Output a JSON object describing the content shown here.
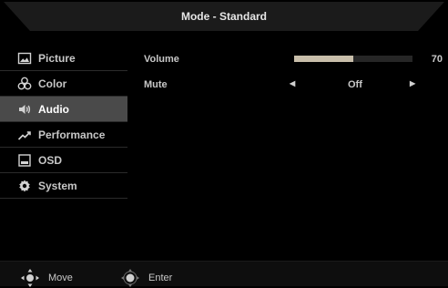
{
  "header": {
    "title": "Mode - Standard"
  },
  "sidebar": {
    "items": [
      {
        "label": "Picture",
        "icon": "picture-icon",
        "active": false
      },
      {
        "label": "Color",
        "icon": "color-icon",
        "active": false
      },
      {
        "label": "Audio",
        "icon": "speaker-icon",
        "active": true
      },
      {
        "label": "Performance",
        "icon": "performance-icon",
        "active": false
      },
      {
        "label": "OSD",
        "icon": "osd-icon",
        "active": false
      },
      {
        "label": "System",
        "icon": "gear-icon",
        "active": false
      }
    ]
  },
  "content": {
    "volume": {
      "label": "Volume",
      "value": "70",
      "level": 0.5
    },
    "mute": {
      "label": "Mute",
      "value": "Off"
    }
  },
  "footer": {
    "move_label": "Move",
    "enter_label": "Enter"
  },
  "colors": {
    "background": "#000000",
    "active_item": "#4a4a4a",
    "text": "#c8c8c8",
    "volume_fill": "#c8beaa",
    "volume_track": "#262626"
  }
}
